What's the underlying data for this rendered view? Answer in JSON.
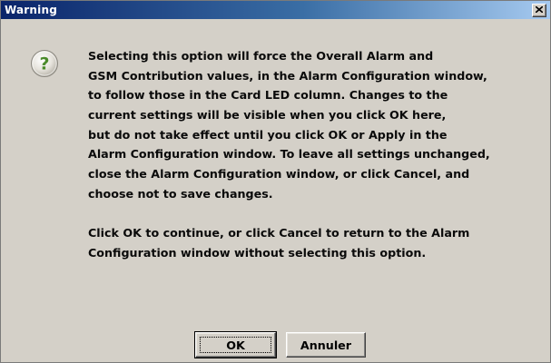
{
  "window": {
    "title": "Warning",
    "close_label": "×"
  },
  "icon": {
    "name": "question-icon",
    "glyph": "?",
    "color": "#4a8a2a"
  },
  "message": {
    "lines": [
      "Selecting this option will force the Overall Alarm and",
      "GSM Contribution values, in the Alarm Configuration window,",
      "to follow those in the Card LED column. Changes to the",
      "current settings will be visible when you click OK here,",
      "but do not take effect until you click OK or Apply in the",
      "Alarm Configuration window. To leave all settings unchanged,",
      "close the Alarm Configuration window, or click Cancel, and",
      "choose not to save changes."
    ],
    "lines2": [
      "Click OK to continue, or click Cancel to return to the Alarm",
      "Configuration window without selecting this option."
    ]
  },
  "buttons": {
    "ok_label": "OK",
    "cancel_label": "Annuler"
  },
  "colors": {
    "title_bar_start": "#0a246a",
    "title_bar_end": "#a6caf0",
    "dialog_bg": "#d4d0c8"
  }
}
